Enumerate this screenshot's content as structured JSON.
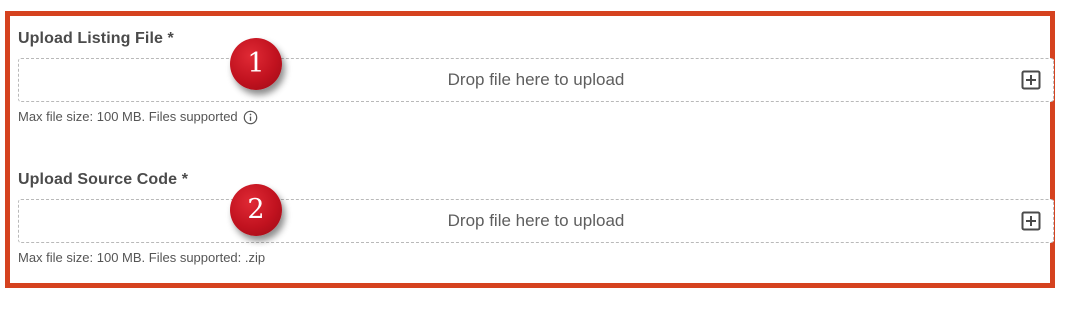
{
  "upload_listing": {
    "label": "Upload Listing File *",
    "dropzone_text": "Drop file here to upload",
    "hint": "Max file size: 100 MB. Files supported",
    "add_icon": "plus-square-icon",
    "info_icon": "info-circle-icon"
  },
  "upload_source": {
    "label": "Upload Source Code *",
    "dropzone_text": "Drop file here to upload",
    "hint": "Max file size: 100 MB. Files supported: .zip",
    "add_icon": "plus-square-icon"
  },
  "annotations": [
    {
      "label": "1"
    },
    {
      "label": "2"
    }
  ],
  "colors": {
    "frame_border": "#d5421f",
    "marker_fill": "#c1121f",
    "label_text": "#4b4b4b",
    "dropzone_border": "#b9b9b9"
  }
}
